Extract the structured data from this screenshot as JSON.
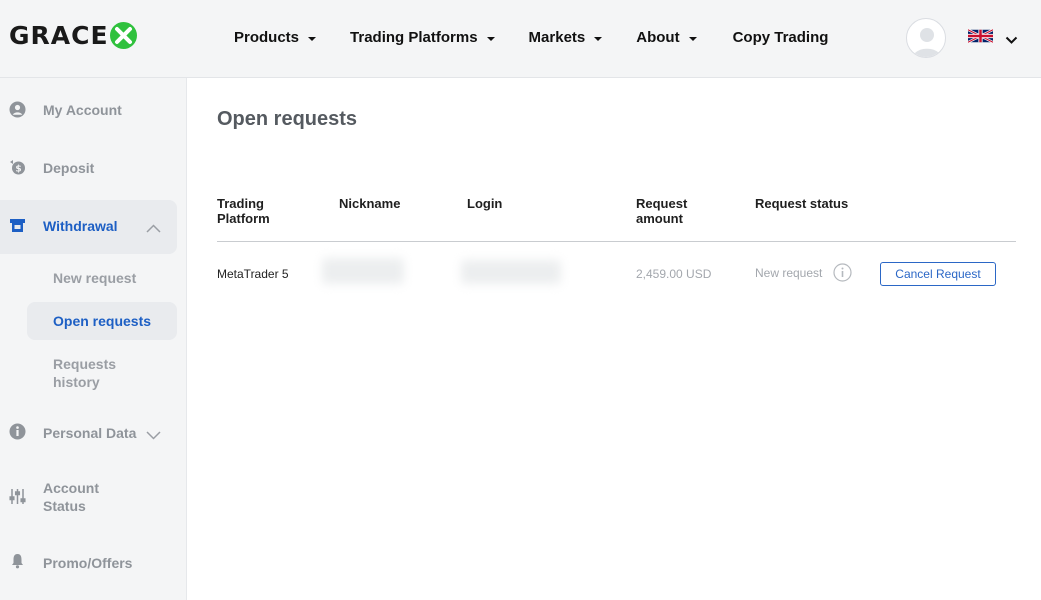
{
  "brand": {
    "logo_text": "GRACE",
    "logo_accent": "X",
    "accent_color": "#2fc13d"
  },
  "nav": {
    "items": [
      {
        "label": "Products",
        "has_dropdown": true
      },
      {
        "label": "Trading Platforms",
        "has_dropdown": true
      },
      {
        "label": "Markets",
        "has_dropdown": true
      },
      {
        "label": "About",
        "has_dropdown": true
      },
      {
        "label": "Copy Trading",
        "has_dropdown": false
      }
    ],
    "language_icon": "uk-flag-icon"
  },
  "sidebar": {
    "items": [
      {
        "label": "My Account",
        "icon": "user-circle-icon"
      },
      {
        "label": "Deposit",
        "icon": "deposit-icon"
      },
      {
        "label": "Withdrawal",
        "icon": "withdrawal-icon",
        "active": true,
        "expanded": true,
        "children": [
          {
            "label": "New request"
          },
          {
            "label": "Open requests",
            "active": true
          },
          {
            "label": "Requests history"
          }
        ]
      },
      {
        "label": "Personal Data",
        "icon": "info-circle-icon",
        "expandable": true
      },
      {
        "label": "Account Status",
        "icon": "sliders-icon"
      },
      {
        "label": "Promo/Offers",
        "icon": "bell-icon"
      }
    ],
    "active_color": "#1d5fc4"
  },
  "main": {
    "title": "Open requests",
    "table": {
      "columns": [
        "Trading Platform",
        "Nickname",
        "Login",
        "Request amount",
        "Request status"
      ],
      "rows": [
        {
          "platform": "MetaTrader 5",
          "nickname": "",
          "login": "",
          "amount": "2,459.00 USD",
          "status": "New request",
          "action": "Cancel Request"
        }
      ]
    }
  }
}
